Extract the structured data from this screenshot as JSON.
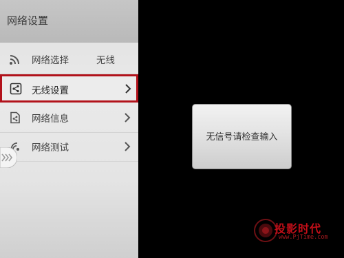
{
  "sidebar": {
    "title": "网络设置",
    "items": [
      {
        "label": "网络选择",
        "value": "无线",
        "icon": "wifi-signal-icon"
      },
      {
        "label": "无线设置",
        "icon": "wireless-settings-icon",
        "selected": true
      },
      {
        "label": "网络信息",
        "icon": "network-info-icon"
      },
      {
        "label": "网络测试",
        "icon": "network-test-icon"
      }
    ]
  },
  "popup": {
    "message": "无信号请检查输入"
  },
  "watermark": {
    "name": "投影时代",
    "url": "www.PjTime.com"
  },
  "colors": {
    "selection_border": "#b2121b",
    "background": "#000000",
    "sidebar": "#e4e4e4"
  }
}
